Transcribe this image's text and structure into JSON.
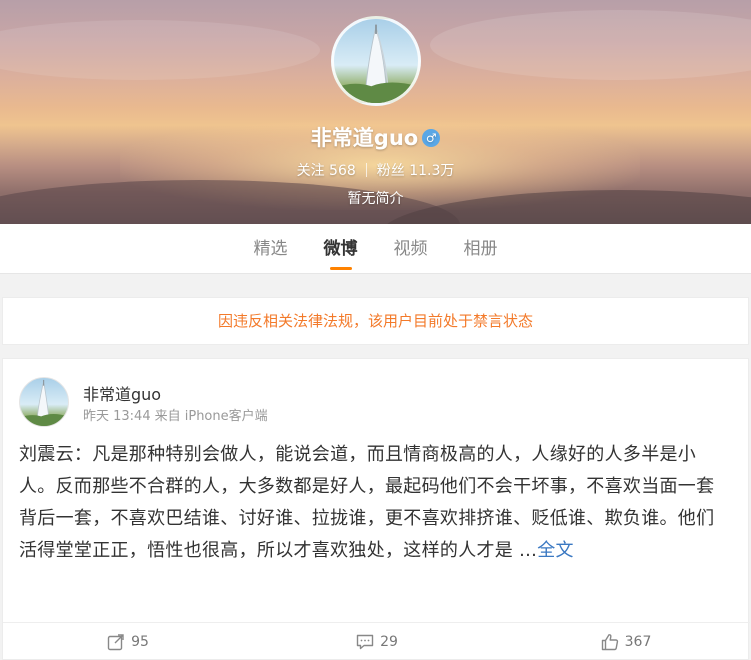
{
  "profile": {
    "name": "非常道guo",
    "gender_icon": "male-icon",
    "following_label": "关注",
    "following_count": "568",
    "followers_label": "粉丝",
    "followers_count": "11.3万",
    "bio": "暂无简介"
  },
  "tabs": [
    {
      "label": "精选",
      "active": false
    },
    {
      "label": "微博",
      "active": true
    },
    {
      "label": "视频",
      "active": false
    },
    {
      "label": "相册",
      "active": false
    }
  ],
  "notice": "因违反相关法律法规，该用户目前处于禁言状态",
  "post": {
    "user": "非常道guo",
    "time": "昨天 13:44",
    "source": "来自 iPhone客户端",
    "text": "刘震云：凡是那种特别会做人，能说会道，而且情商极高的人，人缘好的人多半是小人。反而那些不合群的人，大多数都是好人，最起码他们不会干坏事，不喜欢当面一套背后一套，不喜欢巴结谁、讨好谁、拉拢谁，更不喜欢排挤谁、贬低谁、欺负谁。他们活得堂堂正正，悟性也很高，所以才喜欢独处，这样的人才是 ...",
    "more_label": "全文",
    "reposts": "95",
    "comments": "29",
    "likes": "367"
  },
  "colors": {
    "accent": "#ff8200",
    "notice": "#f37a2a",
    "link": "#3a78c2"
  }
}
